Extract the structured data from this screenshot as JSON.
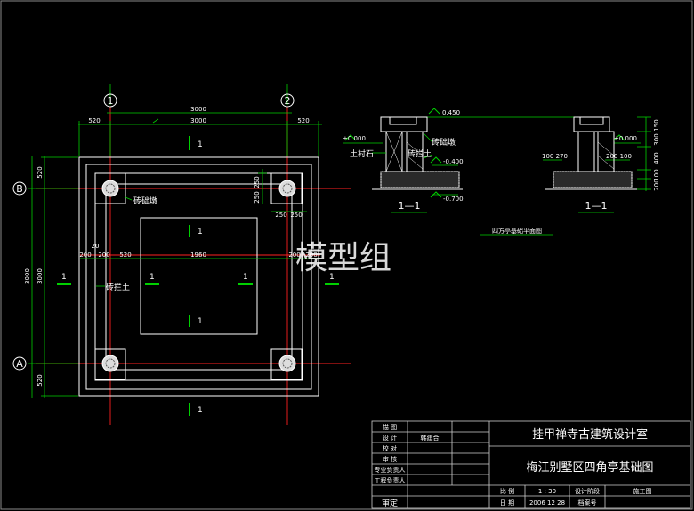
{
  "drawing": {
    "axes": {
      "col1": "1",
      "col2": "2",
      "rowB": "B",
      "rowA": "A"
    },
    "plan_dims": {
      "top_total": "3000",
      "top_inner": "3000",
      "top_left": "520",
      "top_right": "520",
      "left_total": "3000",
      "left_inner": "3000",
      "left_top": "520",
      "left_bottom": "520",
      "d250a": "250",
      "d250b": "250",
      "d250c": "250",
      "d250d": "250",
      "d20": "20",
      "d200a": "200",
      "d200b": "200",
      "d520": "520",
      "d1960": "1960",
      "d200c": "200",
      "d200d": "200"
    },
    "section_marks": {
      "top": "1",
      "bottom": "1",
      "left": "1",
      "right": "1",
      "inner_top": "1",
      "inner_bottom": "1",
      "inner_left": "1",
      "inner_right": "1"
    },
    "plan_labels": {
      "pier": "砖础墩",
      "wall": "砖拦土"
    },
    "section": {
      "elev_top": "0.450",
      "elev_zero_left": "±0.000",
      "elev_zero_right": "±0.000",
      "elev_m400": "-0.400",
      "elev_m700": "-0.700",
      "label_pier": "砖础墩",
      "label_wall": "砖拦土",
      "label_stone": "土衬石",
      "dim_100_270": "100  270",
      "dim_200_100": "200 100",
      "dim_r1": "150",
      "dim_r2": "300",
      "dim_r3": "400",
      "dim_r4": "100",
      "dim_r5": "200",
      "tag_left": "1—1",
      "tag_right": "1—1",
      "caption": "四方亭基础平面图"
    },
    "watermark": "模型组"
  },
  "title_block": {
    "rows": [
      "描  图",
      "设  计",
      "校  对",
      "审  核",
      "专业负责人",
      "工程负责人"
    ],
    "designer": "韩建合",
    "bottom_left": "审定",
    "institute": "挂甲禅寺古建筑设计室",
    "project": "梅江别墅区四角亭基础图",
    "scale_label": "比  例",
    "scale_value": "1 : 30",
    "phase_label": "设计阶段",
    "phase_value": "施工图",
    "date_label": "日  期",
    "date_value": "2006 12 28",
    "archive_label": "档案号"
  }
}
